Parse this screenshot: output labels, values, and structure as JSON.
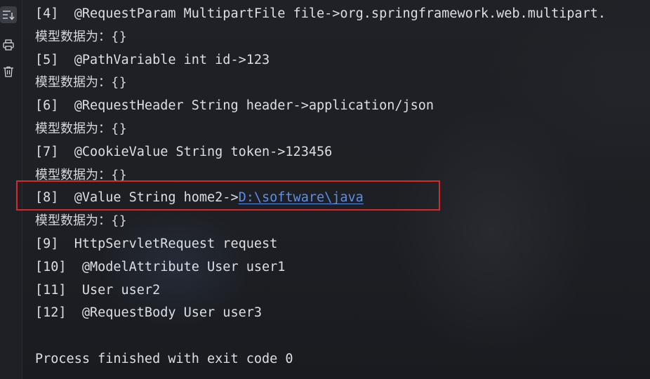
{
  "gutter": {
    "buttons": [
      {
        "icon": "soft-wrap-down-icon",
        "active": true
      },
      {
        "icon": "print-icon",
        "active": false
      },
      {
        "icon": "trash-icon",
        "active": false
      }
    ]
  },
  "console": {
    "lines": [
      {
        "text": "[4]  @RequestParam MultipartFile file->org.springframework.web.multipart.",
        "kind": "mono"
      },
      {
        "text": "模型数据为：{}",
        "kind": "cjk"
      },
      {
        "text": "[5]  @PathVariable int id->123",
        "kind": "mono"
      },
      {
        "text": "模型数据为：{}",
        "kind": "cjk"
      },
      {
        "text": "[6]  @RequestHeader String header->application/json",
        "kind": "mono"
      },
      {
        "text": "模型数据为：{}",
        "kind": "cjk"
      },
      {
        "text": "[7]  @CookieValue String token->123456",
        "kind": "mono"
      },
      {
        "text": "模型数据为：{}",
        "kind": "cjk"
      },
      {
        "text": "[8]  @Value String home2->",
        "link": "D:\\software\\java",
        "kind": "mono"
      },
      {
        "text": "模型数据为：{}",
        "kind": "cjk"
      },
      {
        "text": "[9]  HttpServletRequest request",
        "kind": "mono"
      },
      {
        "text": "[10]  @ModelAttribute User user1",
        "kind": "mono"
      },
      {
        "text": "[11]  User user2",
        "kind": "mono"
      },
      {
        "text": "[12]  @RequestBody User user3",
        "kind": "mono"
      },
      {
        "text": "",
        "kind": "mono"
      },
      {
        "text": "Process finished with exit code 0",
        "kind": "mono"
      }
    ]
  },
  "colors": {
    "highlight_border": "#d42a2a",
    "link": "#5b8fe8",
    "text": "#dcdfe4"
  }
}
